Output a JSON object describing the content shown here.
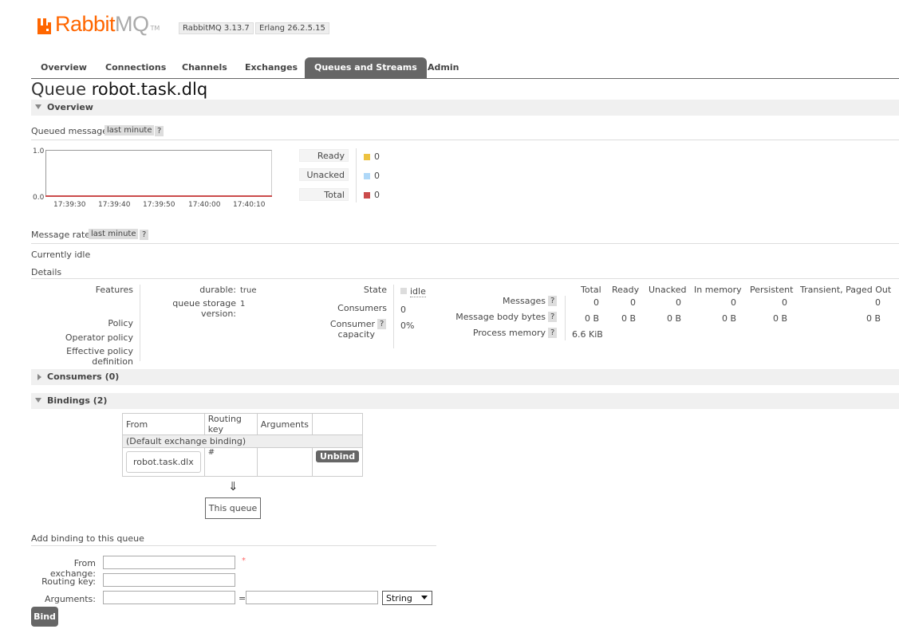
{
  "header": {
    "logo_rabbit": "Rabbit",
    "logo_mq": "MQ",
    "logo_tm": "TM",
    "rabbitmq_version": "RabbitMQ 3.13.7",
    "erlang_version": "Erlang 26.2.5.15"
  },
  "tabs": [
    {
      "label": "Overview"
    },
    {
      "label": "Connections"
    },
    {
      "label": "Channels"
    },
    {
      "label": "Exchanges"
    },
    {
      "label": "Queues and Streams",
      "active": true
    },
    {
      "label": "Admin"
    }
  ],
  "page": {
    "title_prefix": "Queue",
    "queue_name": "robot.task.dlq"
  },
  "overview": {
    "section_label": "Overview",
    "queued_messages": {
      "label": "Queued messages",
      "range": "last minute",
      "help": "?"
    },
    "chart_y_max": "1.0",
    "chart_y_min": "0.0",
    "chart_x_ticks": [
      "17:39:30",
      "17:39:40",
      "17:39:50",
      "17:40:00",
      "17:40:10"
    ],
    "legend": [
      {
        "label": "Ready",
        "value": "0",
        "color": "#edc240"
      },
      {
        "label": "Unacked",
        "value": "0",
        "color": "#afd8f8"
      },
      {
        "label": "Total",
        "value": "0",
        "color": "#cb4b4b"
      }
    ],
    "message_rates": {
      "label": "Message rates",
      "range": "last minute",
      "help": "?"
    },
    "idle_text": "Currently idle",
    "details_label": "Details"
  },
  "details": {
    "features_label": "Features",
    "durable_key": "durable:",
    "durable_val": "true",
    "storage_key": "queue storage version:",
    "storage_val": "1",
    "policy_label": "Policy",
    "operator_policy_label": "Operator policy",
    "effective_policy_label": "Effective policy definition",
    "state_label": "State",
    "state_val": "idle",
    "consumers_label": "Consumers",
    "consumers_val": "0",
    "consumer_capacity_label": "Consumer capacity",
    "consumer_capacity_val": "0%",
    "help": "?"
  },
  "stats": {
    "headers": [
      "Total",
      "Ready",
      "Unacked",
      "In memory",
      "Persistent",
      "Transient, Paged Out"
    ],
    "messages_label": "Messages",
    "messages": [
      "0",
      "0",
      "0",
      "0",
      "0",
      "0"
    ],
    "body_bytes_label": "Message body bytes",
    "body_bytes": [
      "0 B",
      "0 B",
      "0 B",
      "0 B",
      "0 B",
      "0 B"
    ],
    "process_memory_label": "Process memory",
    "process_memory": "6.6 KiB"
  },
  "consumers_section": "Consumers (0)",
  "bindings_section": "Bindings (2)",
  "bindings": {
    "headers": [
      "From",
      "Routing key",
      "Arguments"
    ],
    "default_row": "(Default exchange binding)",
    "row_from": "robot.task.dlx",
    "row_key": "#",
    "unbind_label": "Unbind",
    "arrow": "⇓",
    "this_queue": "This queue"
  },
  "add_binding": {
    "title": "Add binding to this queue",
    "from_label": "From exchange:",
    "required_mark": "*",
    "routing_label": "Routing key:",
    "arguments_label": "Arguments:",
    "equals": "=",
    "type_selected": "String",
    "bind_label": "Bind"
  }
}
